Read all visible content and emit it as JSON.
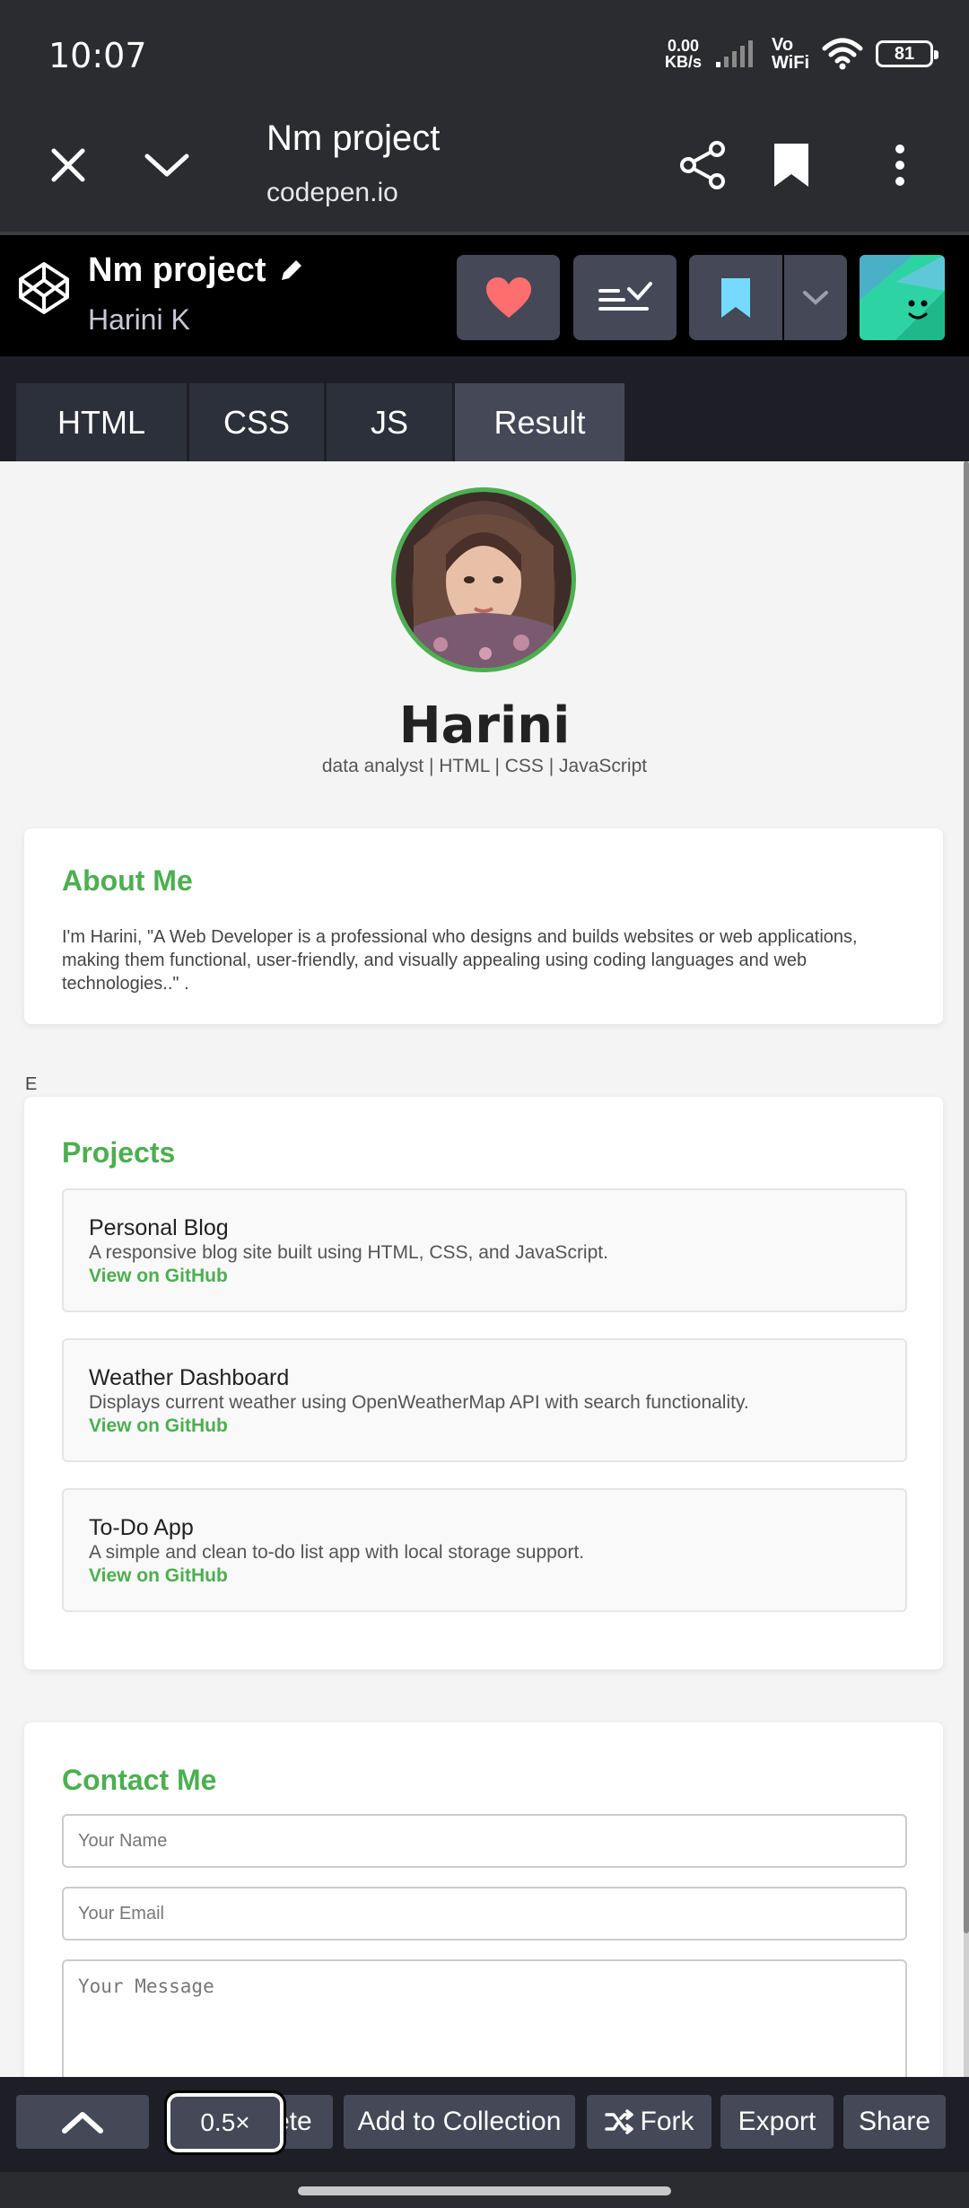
{
  "status": {
    "time": "10:07",
    "net_speed_value": "0.00",
    "net_speed_unit": "KB/s",
    "vowifi_top": "Vo",
    "vowifi_bottom": "WiFi",
    "battery": "81"
  },
  "browser": {
    "page_title": "Nm project",
    "domain": "codepen.io",
    "icons": [
      "close-icon",
      "chevron-down-icon",
      "share-icon",
      "bookmark-icon",
      "more-vert-icon"
    ]
  },
  "codepen": {
    "pen_title": "Nm project",
    "author": "Harini K",
    "icons": [
      "codepen-logo",
      "pencil-icon",
      "heart-icon",
      "layout-icon",
      "bookmark-icon",
      "chevron-down-icon"
    ],
    "colors": {
      "heart": "#ff6e6e",
      "bookmark": "#76daff",
      "avatar_bg": "#2ed3a4"
    }
  },
  "tabs": [
    {
      "label": "HTML"
    },
    {
      "label": "CSS"
    },
    {
      "label": "JS"
    },
    {
      "label": "Result",
      "active": true
    }
  ],
  "profile": {
    "name": "Harini",
    "subtitle": "data analyst | HTML | CSS | JavaScript"
  },
  "about": {
    "heading": "About Me",
    "text": "I'm Harini, \"A Web Developer is a professional who designs and builds websites or web applications, making them functional, user-friendly, and visually appealing using coding languages and web technologies..\" ."
  },
  "stray_text": "E",
  "projects": {
    "heading": "Projects",
    "items": [
      {
        "title": "Personal Blog",
        "desc": "A responsive blog site built using HTML, CSS, and JavaScript.",
        "link": "View on GitHub"
      },
      {
        "title": "Weather Dashboard",
        "desc": "Displays current weather using OpenWeatherMap API with search functionality.",
        "link": "View on GitHub"
      },
      {
        "title": "To-Do App",
        "desc": "A simple and clean to-do list app with local storage support.",
        "link": "View on GitHub"
      }
    ]
  },
  "contact": {
    "heading": "Contact Me",
    "name_placeholder": "Your Name",
    "email_placeholder": "Your Email",
    "message_placeholder": "Your Message"
  },
  "toolbar": {
    "zoom": "0.5×",
    "delete_partial": "ete",
    "add_to_collection": "Add to Collection",
    "fork": "Fork",
    "export": "Export",
    "share": "Share"
  },
  "accent": "#4caf50"
}
